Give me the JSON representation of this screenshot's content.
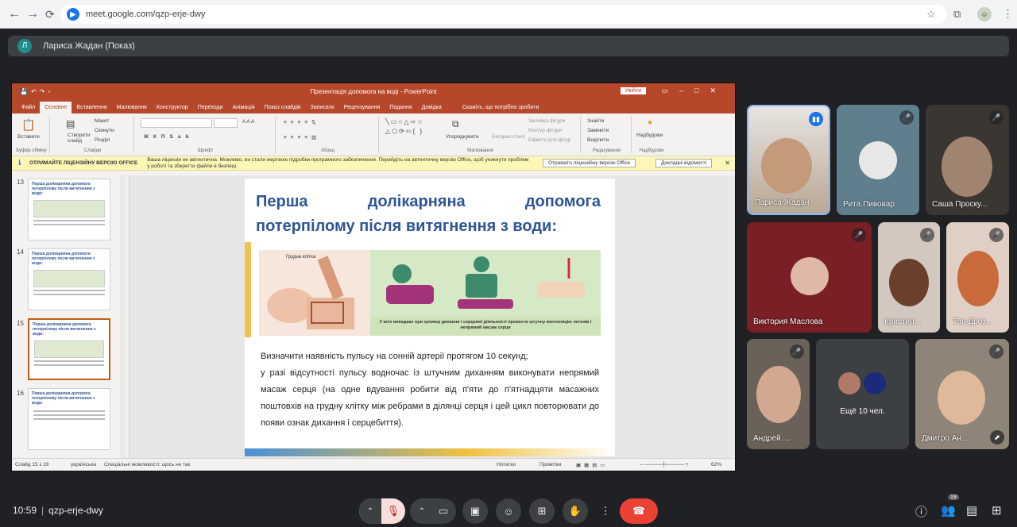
{
  "browser": {
    "url": "meet.google.com/qzp-erje-dwy",
    "site_icon": "meet-icon"
  },
  "presenter": {
    "initial": "Л",
    "label": "Лариса Жадан (Показ)"
  },
  "powerpoint": {
    "window_title": "Презентація  допомога на воді  -  PowerPoint",
    "login_button": "Увійти",
    "menu_tabs": [
      "Файл",
      "Основне",
      "Вставлення",
      "Малювання",
      "Конструктор",
      "Переходи",
      "Анімація",
      "Показ слайдів",
      "Записати",
      "Рецензування",
      "Подання",
      "Довідка"
    ],
    "active_tab": "Основне",
    "tell_me": "Скажіть, що потрібно зробити",
    "ribbon": {
      "paste": "Вставити",
      "clipboard": "Буфер обміну",
      "new_slide": "Створити слайд",
      "layout": "Макет",
      "reset": "Скинути",
      "section": "Розділ",
      "slides": "Слайди",
      "font": "Шрифт",
      "paragraph": "Абзац",
      "arrange": "Упорядкувати",
      "quick_styles": "Експрес-стилі",
      "shape_fill": "Заливка фігури",
      "shape_outline": "Контур фігури",
      "shape_effects": "Ефекти для фігур",
      "drawing": "Малювання",
      "find": "Знайти",
      "replace": "Замінити",
      "select": "Виділити",
      "editing": "Редагування",
      "addins": "Надбудови",
      "addins_group": "Надбудови"
    },
    "license_bar": {
      "title": "ОТРИМАЙТЕ ЛІЦЕНЗІЙНУ ВЕРСІЮ OFFICE",
      "message": "Ваша ліцензія не автентична. Можливо, ви стали жертвою підробки програмного забезпечення. Перейдіть на автентичну версію Office, щоб уникнути проблем у роботі та зберегти файли в безпеці.",
      "button_get": "Отримати ліцензійну версію Office",
      "button_more": "Докладні відомості"
    },
    "thumbnails": [
      {
        "num": "13",
        "title": "Перша долікарняна допомога потерпілому після витягнення з води:"
      },
      {
        "num": "14",
        "title": "Перша долікарняна допомога потерпілому після витягнення з води:"
      },
      {
        "num": "15",
        "title": "Перша долікарняна допомога потерпілому після витягнення з води:"
      },
      {
        "num": "16",
        "title": "Перша долікарняна допомога потерпілому після витягнення з води:"
      }
    ],
    "slide": {
      "title_line1_words": [
        "Перша",
        "долікарняна",
        "допомога"
      ],
      "title_line2": "потерпілому після витягнення з води:",
      "image_label": "Грудна клітка",
      "image_caption": "У всіх випадках при зупинці дихання і серцевої діяльності провести штучну вентиляцію легенів і непрямий масаж серця",
      "paragraph1": "Визначити наявність пульсу на сонній артерії протягом 10 секунд;",
      "paragraph2": "у разі відсутності пульсу водночас із штучним диханням виконувати непрямий масаж серця (на одне вдування робити від п'яти до п'ятнадцяти масажних поштовхів на грудну клітку між ребрами в ділянці серця і цей цикл повторювати до появи ознак дихання і серцебиття)."
    },
    "status": {
      "slide_counter": "Слайд 15 з 19",
      "language": "українська",
      "accessibility": "Спеціальні можливості: щось не так",
      "notes": "Нотатки",
      "comments": "Примітки",
      "zoom": "62%"
    }
  },
  "participants": [
    {
      "name": "Лариса Жадан",
      "speaking": true,
      "bg": "#c9b9a6"
    },
    {
      "name": "Рита Пивовар",
      "speaking": false,
      "bg": "#5f7f8c"
    },
    {
      "name": "Саша Проску...",
      "speaking": false,
      "bg": "#3a3632"
    },
    {
      "name": "Виктория Маслова",
      "speaking": false,
      "bg": "#7a1f25"
    },
    {
      "name": "Кристин...",
      "speaking": false,
      "bg": "#d3c8c0"
    },
    {
      "name": "Тая Дроз...",
      "speaking": false,
      "bg": "#e0cfc4"
    },
    {
      "name": "Андрей ...",
      "speaking": false,
      "bg": "#6a6258"
    },
    {
      "name": "Ещё 10 чел.",
      "speaking": false,
      "bg": "#3c4043"
    },
    {
      "name": "Дмитро Ан...",
      "speaking": false,
      "bg": "#8e8478"
    }
  ],
  "bottom": {
    "time": "10:59",
    "meeting_code": "qzp-erje-dwy",
    "participants_count": "19"
  },
  "colors": {
    "ppt_accent": "#b7472a",
    "meet_bg": "#202124",
    "end_call": "#ea4335",
    "mic_off": "#f9dedc"
  }
}
